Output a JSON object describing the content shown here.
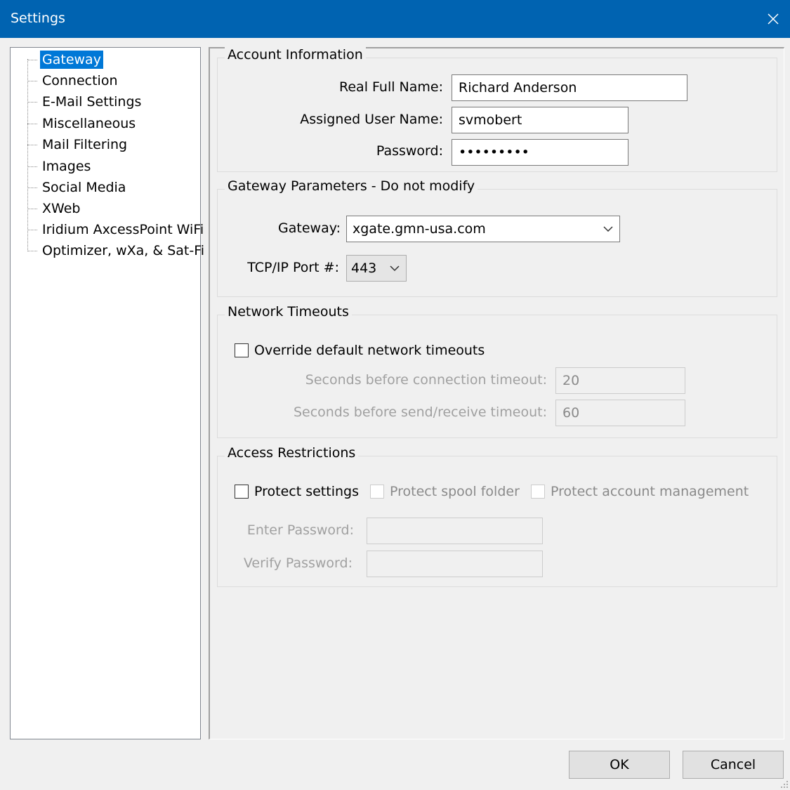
{
  "window": {
    "title": "Settings"
  },
  "tree": {
    "items": [
      {
        "label": "Gateway",
        "selected": true
      },
      {
        "label": "Connection"
      },
      {
        "label": "E-Mail Settings"
      },
      {
        "label": "Miscellaneous"
      },
      {
        "label": "Mail Filtering"
      },
      {
        "label": "Images"
      },
      {
        "label": "Social Media"
      },
      {
        "label": "XWeb"
      },
      {
        "label": "Iridium AxcessPoint WiFi"
      },
      {
        "label": "Optimizer, wXa, & Sat-Fi"
      }
    ]
  },
  "account": {
    "title": "Account Information",
    "real_name_label": "Real Full Name:",
    "real_name": "Richard Anderson",
    "user_name_label": "Assigned User Name:",
    "user_name": "svmobert",
    "password_label": "Password:",
    "password": "ppppppppp"
  },
  "gateway": {
    "title": "Gateway Parameters - Do not modify",
    "gateway_label": "Gateway:",
    "gateway_value": "xgate.gmn-usa.com",
    "port_label": "TCP/IP Port #:",
    "port_value": "443"
  },
  "timeouts": {
    "title": "Network Timeouts",
    "override_label": "Override default network timeouts",
    "override_checked": false,
    "connection_label": "Seconds before connection timeout:",
    "connection_value": "20",
    "sendrecv_label": "Seconds before send/receive timeout:",
    "sendrecv_value": "60"
  },
  "access": {
    "title": "Access Restrictions",
    "protect_settings_label": "Protect settings",
    "protect_spool_label": "Protect spool folder",
    "protect_account_label": "Protect account management",
    "enter_password_label": "Enter Password:",
    "verify_password_label": "Verify Password:"
  },
  "buttons": {
    "ok": "OK",
    "cancel": "Cancel"
  }
}
